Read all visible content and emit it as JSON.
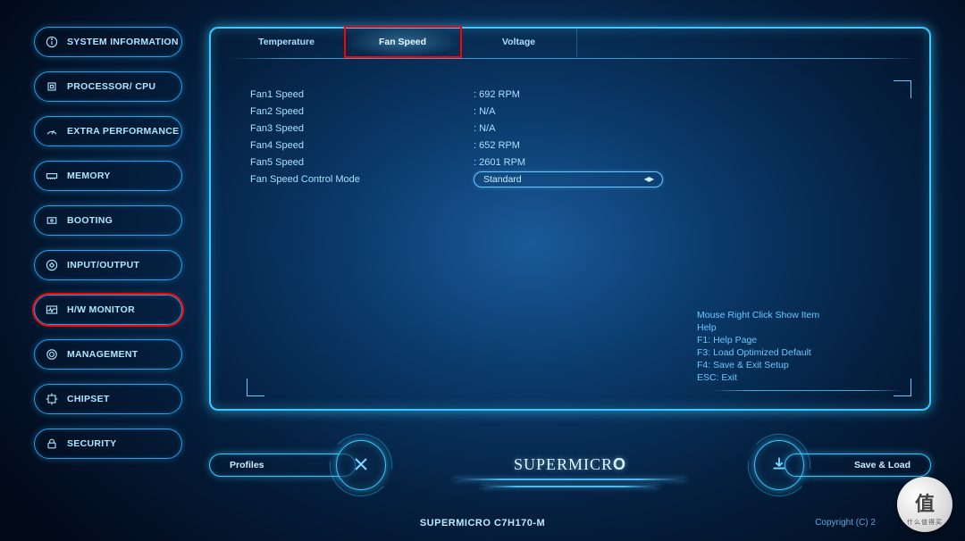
{
  "sidebar": {
    "items": [
      {
        "label": "SYSTEM INFORMATION",
        "icon": "info"
      },
      {
        "label": "PROCESSOR/ CPU",
        "icon": "cpu"
      },
      {
        "label": "EXTRA PERFORMANCE",
        "icon": "perf"
      },
      {
        "label": "MEMORY",
        "icon": "mem"
      },
      {
        "label": "BOOTING",
        "icon": "boot"
      },
      {
        "label": "INPUT/OUTPUT",
        "icon": "io"
      },
      {
        "label": "H/W MONITOR",
        "icon": "hw",
        "highlight": true
      },
      {
        "label": "MANAGEMENT",
        "icon": "mgmt"
      },
      {
        "label": "CHIPSET",
        "icon": "chip"
      },
      {
        "label": "SECURITY",
        "icon": "sec"
      }
    ]
  },
  "tabs": [
    {
      "label": "Temperature",
      "active": false
    },
    {
      "label": "Fan Speed",
      "active": true,
      "highlight": true
    },
    {
      "label": "Voltage",
      "active": false
    }
  ],
  "fan_speed": {
    "rows": [
      {
        "label": "Fan1 Speed",
        "value": ": 692 RPM"
      },
      {
        "label": "Fan2 Speed",
        "value": ": N/A"
      },
      {
        "label": "Fan3 Speed",
        "value": ": N/A"
      },
      {
        "label": "Fan4 Speed",
        "value": ": 652 RPM"
      },
      {
        "label": "Fan5 Speed",
        "value": ": 2601 RPM"
      }
    ],
    "control_label": "Fan Speed Control Mode",
    "control_value": "Standard"
  },
  "help": {
    "lines": [
      "Mouse Right Click Show Item",
      "Help",
      "F1: Help Page",
      "F3: Load Optimized Default",
      "F4: Save & Exit Setup",
      "ESC: Exit"
    ]
  },
  "bottom": {
    "profiles_label": "Profiles",
    "saveload_label": "Save & Load",
    "brand": "SUPERMICR",
    "brand_o": "O"
  },
  "footer": {
    "model": "SUPERMICRO C7H170-M",
    "copyright": "Copyright (C) 2"
  },
  "watermark": {
    "char": "值",
    "ring": "什么值得买"
  }
}
